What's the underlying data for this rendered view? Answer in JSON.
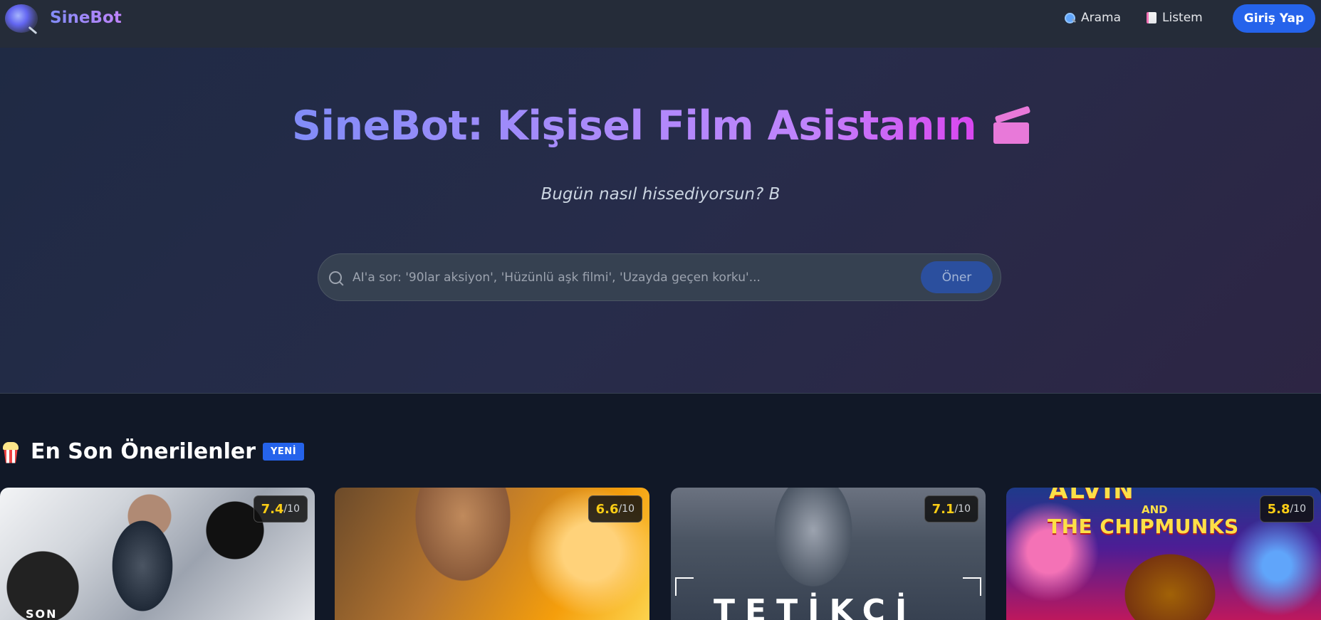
{
  "header": {
    "brand": "SineBot",
    "nav": [
      {
        "label": "Arama",
        "icon": "magnifier-icon"
      },
      {
        "label": "Listem",
        "icon": "document-icon"
      }
    ],
    "login_label": "Giriş Yap"
  },
  "hero": {
    "title": "SineBot: Kişisel Film Asistanın",
    "title_icon": "clapperboard-icon",
    "subtitle": "Bugün nasıl hissediyorsun? B",
    "search_placeholder": "AI'a sor: '90lar aksiyon', 'Hüzünlü aşk filmi', 'Uzayda geçen korku'...",
    "search_value": "",
    "submit_label": "Öner"
  },
  "section": {
    "icon": "popcorn-icon",
    "title": "En Son Önerilenler",
    "badge": "YENİ"
  },
  "cards": [
    {
      "score": "7.4",
      "max": "/10",
      "poster_text": "SON"
    },
    {
      "score": "6.6",
      "max": "/10",
      "poster_text": ""
    },
    {
      "score": "7.1",
      "max": "/10",
      "poster_text": "TETİKÇİ"
    },
    {
      "score": "5.8",
      "max": "/10",
      "poster_text": "THE CHIPMUNKS",
      "poster_top": "ALVIN",
      "poster_and": "AND"
    }
  ],
  "colors": {
    "accent": "#2563eb",
    "rating": "#facc15",
    "brand_gradient_start": "#818cf8",
    "brand_gradient_end": "#c084fc"
  }
}
